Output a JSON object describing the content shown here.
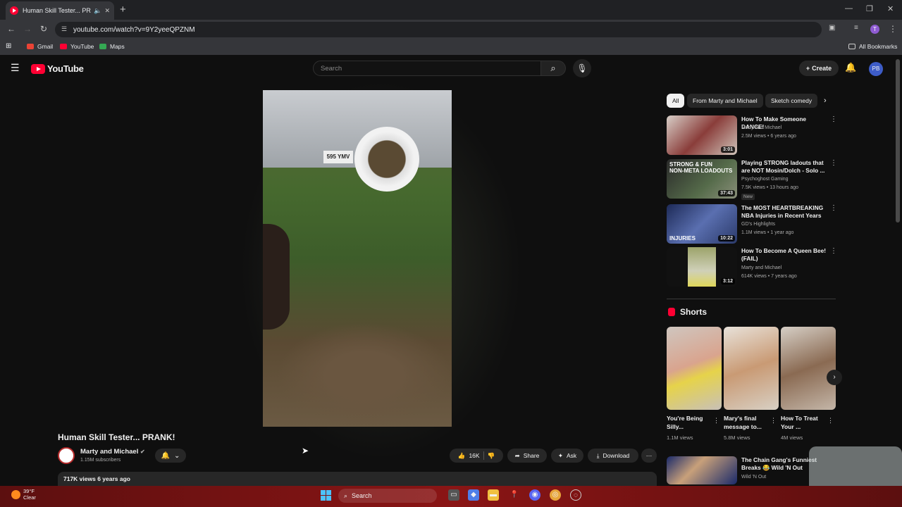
{
  "browser": {
    "tab_title": "Human Skill Tester... PRANK!",
    "url": "youtube.com/watch?v=9Y2yeeQPZNM",
    "bookmarks": [
      "Gmail",
      "YouTube",
      "Maps"
    ],
    "all_bookmarks": "All Bookmarks",
    "profile_initial": "T"
  },
  "header": {
    "logo": "YouTube",
    "search_placeholder": "Search",
    "create_label": "Create",
    "avatar_text": "PB"
  },
  "video": {
    "title": "Human Skill Tester... PRANK!",
    "plate": "595 YMV",
    "channel": "Marty and Michael",
    "subscribers": "1.15M subscribers",
    "likes": "16K",
    "share": "Share",
    "ask": "Ask",
    "download": "Download",
    "views_date": "717K views  6 years ago"
  },
  "chips": [
    "All",
    "From Marty and Michael",
    "Sketch comedy"
  ],
  "recommendations": [
    {
      "title": "How To Make Someone DANCE!",
      "channel": "Marty and Michael",
      "meta": "2.5M views • 6 years ago",
      "duration": "3:01",
      "badge": ""
    },
    {
      "title": "Playing STRONG ladouts that are NOT Mosin/Dolch - Solo ...",
      "channel": "Psychoghost Gaming",
      "meta": "7.5K views • 13 hours ago",
      "duration": "37:43",
      "badge": "New"
    },
    {
      "title": "The MOST HEARTBREAKING NBA Injuries in Recent Years 💔",
      "channel": "GD's Highlights",
      "meta": "1.1M views • 1 year ago",
      "duration": "10:22",
      "badge": ""
    },
    {
      "title": "How To Become A Queen Bee! (FAIL)",
      "channel": "Marty and Michael",
      "meta": "614K views • 7 years ago",
      "duration": "3:12",
      "badge": ""
    }
  ],
  "shorts": {
    "title": "Shorts",
    "items": [
      {
        "name": "You're Being Silly...",
        "views": "1.1M views"
      },
      {
        "name": "Mary's final message to...",
        "views": "5.8M views"
      },
      {
        "name": "How To Treat Your ...",
        "views": "4M views"
      }
    ]
  },
  "next_rec": {
    "title": "The Chain Gang's Funniest Breaks 😂 Wild 'N Out",
    "channel": "Wild 'N Out"
  },
  "taskbar": {
    "temp": "39°F",
    "cond": "Clear",
    "search": "Search"
  },
  "colors": {
    "accent": "#ff0033",
    "bg": "#0f0f0f",
    "chip": "#272727"
  }
}
